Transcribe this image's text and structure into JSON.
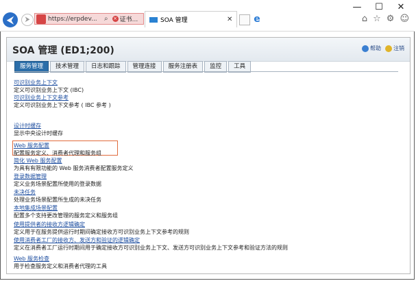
{
  "window_controls": {
    "minimize": "—",
    "maximize": "☐",
    "close": "✕"
  },
  "browser": {
    "back_icon": "back-arrow-icon",
    "url": "https://erpdev...",
    "cert_text": "证书...",
    "tab_title": "SOA 管理",
    "tab_close": "✕",
    "ie_glyph": "e",
    "tools": [
      "⌂",
      "☆",
      "⚙",
      "☺"
    ]
  },
  "page": {
    "title": "SOA 管理 (ED1;200)",
    "help": "帮助",
    "logoff": "注销",
    "tabs": [
      "服务管理",
      "技术管理",
      "日志和跟踪",
      "管理连接",
      "服务注册表",
      "监控",
      "工具"
    ],
    "active_tab": 0,
    "items": [
      {
        "link": "可识别业务上下文",
        "desc": "定义可识别业务上下文 (IBC)"
      },
      {
        "link": "可识别业务上下文参考",
        "desc": "定义可识别业务上下文参考 ( IBC 参考 )"
      },
      {
        "link": "设计时缓存",
        "desc": "显示中央设计时缓存"
      },
      {
        "link": "Web 服务配置",
        "desc": "配置服务定义、消费者代理和服务组"
      },
      {
        "link": "简化 Web 服务配置",
        "desc": "为具有有限功能的 Web 服务消费者配置服务定义"
      },
      {
        "link": "登录数据管理",
        "desc": "定义业务场景配置所使用的登录数据"
      },
      {
        "link": "未决任务",
        "desc": "处理业务场景配置所生成的未决任务"
      },
      {
        "link": "本地集成场景配置",
        "desc": "配置多个支持更改管理的服务定义和服务组"
      },
      {
        "link": "使用提供者的接收方逻辑确定",
        "desc": "定义用于在服务提供运行时期间确定接收方可识别业务上下文参考的规则"
      },
      {
        "link": "使用消费者工厂的接收方、发送方和验证的逻辑确定",
        "desc": "定义在消费者工厂运行时期间用于确定接收方可识别业务上下文、发送方可识别业务上下文参考和验证方法的规则"
      },
      {
        "link": "Web 服务检查",
        "desc": "用于检查服务定义和消费者代理的工具"
      }
    ]
  },
  "colors": {
    "active_tab": "#2b6ea9",
    "link": "#1f4fa0",
    "highlight": "#e06b3d",
    "address_bar": "#f6d9d9"
  }
}
